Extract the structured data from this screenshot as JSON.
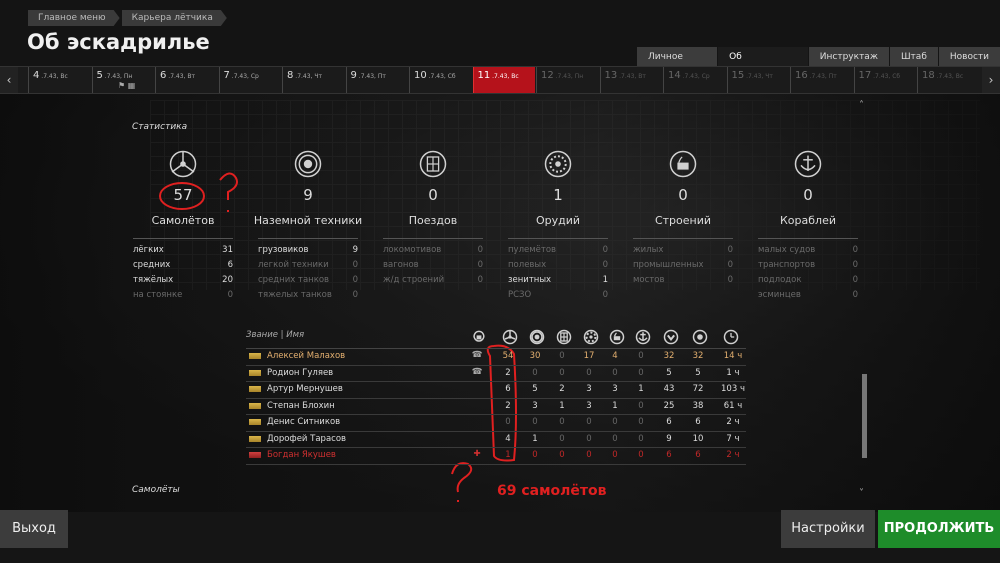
{
  "breadcrumb": [
    "Главное меню",
    "Карьера лётчика"
  ],
  "page_title": "Об эскадрилье",
  "tabs": [
    {
      "label": "Личное дело"
    },
    {
      "label": "Об эскадрилье",
      "active": true
    },
    {
      "label": "Инструктаж"
    },
    {
      "label": "Штаб"
    },
    {
      "label": "Новости"
    }
  ],
  "timeline": [
    {
      "num": "4",
      "date": "7.43, Вс"
    },
    {
      "num": "5",
      "date": "7.43, Пн"
    },
    {
      "num": "6",
      "date": "7.43, Вт"
    },
    {
      "num": "7",
      "date": "7.43, Ср"
    },
    {
      "num": "8",
      "date": "7.43, Чт"
    },
    {
      "num": "9",
      "date": "7.43, Пт"
    },
    {
      "num": "10",
      "date": "7.43, Сб"
    },
    {
      "num": "11",
      "date": "7.43, Вс"
    },
    {
      "num": "12",
      "date": "7.43, Пн"
    },
    {
      "num": "13",
      "date": "7.43, Вт"
    },
    {
      "num": "14",
      "date": "7.43, Ср"
    },
    {
      "num": "15",
      "date": "7.43, Чт"
    },
    {
      "num": "16",
      "date": "7.43, Пт"
    },
    {
      "num": "17",
      "date": "7.43, Сб"
    },
    {
      "num": "18",
      "date": "7.43, Вс"
    }
  ],
  "stats_section_label": "Статистика",
  "stats": [
    {
      "icon": "plane-icon",
      "value": "57",
      "label": "Самолётов",
      "rows": [
        {
          "k": "лёгких",
          "v": "31"
        },
        {
          "k": "средних",
          "v": "6"
        },
        {
          "k": "тяжёлых",
          "v": "20"
        },
        {
          "k": "на стоянке",
          "v": "0"
        }
      ]
    },
    {
      "icon": "ground-vehicle-icon",
      "value": "9",
      "label": "Наземной техники",
      "rows": [
        {
          "k": "грузовиков",
          "v": "9"
        },
        {
          "k": "легкой техники",
          "v": "0"
        },
        {
          "k": "средних танков",
          "v": "0"
        },
        {
          "k": "тяжелых танков",
          "v": "0"
        }
      ]
    },
    {
      "icon": "train-icon",
      "value": "0",
      "label": "Поездов",
      "rows": [
        {
          "k": "локомотивов",
          "v": "0"
        },
        {
          "k": "вагонов",
          "v": "0"
        },
        {
          "k": "ж/д строений",
          "v": "0"
        }
      ]
    },
    {
      "icon": "artillery-icon",
      "value": "1",
      "label": "Орудий",
      "rows": [
        {
          "k": "пулемётов",
          "v": "0"
        },
        {
          "k": "полевых",
          "v": "0"
        },
        {
          "k": "зенитных",
          "v": "1"
        },
        {
          "k": "РСЗО",
          "v": "0"
        }
      ]
    },
    {
      "icon": "building-icon",
      "value": "0",
      "label": "Строений",
      "rows": [
        {
          "k": "жилых",
          "v": "0"
        },
        {
          "k": "промышленных",
          "v": "0"
        },
        {
          "k": "мостов",
          "v": "0"
        }
      ]
    },
    {
      "icon": "ship-icon",
      "value": "0",
      "label": "Кораблей",
      "rows": [
        {
          "k": "малых судов",
          "v": "0"
        },
        {
          "k": "транспортов",
          "v": "0"
        },
        {
          "k": "подлодок",
          "v": "0"
        },
        {
          "k": "эсминцев",
          "v": "0"
        }
      ]
    }
  ],
  "roster": {
    "header": "Звание | Имя",
    "column_icons": [
      "status-icon",
      "plane-icon",
      "ground-vehicle-icon",
      "train-icon",
      "artillery-icon",
      "building-icon",
      "ship-icon",
      "sorties-icon",
      "target-icon",
      "clock-icon"
    ],
    "rows": [
      {
        "name": "Алексей Малахов",
        "mark": "☎",
        "style": "leader",
        "values": [
          "54",
          "30",
          "0",
          "17",
          "4",
          "0",
          "32",
          "32",
          "14 ч"
        ]
      },
      {
        "name": "Родион Гуляев",
        "mark": "☎",
        "style": "",
        "values": [
          "2",
          "0",
          "0",
          "0",
          "0",
          "0",
          "5",
          "5",
          "1 ч"
        ]
      },
      {
        "name": "Артур Мернушев",
        "mark": "",
        "style": "",
        "values": [
          "6",
          "5",
          "2",
          "3",
          "3",
          "1",
          "43",
          "72",
          "103 ч"
        ]
      },
      {
        "name": "Степан Блохин",
        "mark": "",
        "style": "",
        "values": [
          "2",
          "3",
          "1",
          "3",
          "1",
          "0",
          "25",
          "38",
          "61 ч"
        ]
      },
      {
        "name": "Денис Ситников",
        "mark": "",
        "style": "",
        "values": [
          "0",
          "0",
          "0",
          "0",
          "0",
          "0",
          "6",
          "6",
          "2 ч"
        ]
      },
      {
        "name": "Дорофей Тарасов",
        "mark": "",
        "style": "",
        "values": [
          "4",
          "1",
          "0",
          "0",
          "0",
          "0",
          "9",
          "10",
          "7 ч"
        ]
      },
      {
        "name": "Богдан Якушев",
        "mark": "✚",
        "style": "dead",
        "values": [
          "1",
          "0",
          "0",
          "0",
          "0",
          "0",
          "6",
          "6",
          "2 ч"
        ]
      }
    ]
  },
  "planes_section_label": "Самолёты",
  "annotation_text": "69 самолётов",
  "buttons": {
    "exit": "Выход",
    "settings": "Настройки",
    "continue": "ПРОДОЛЖИТЬ"
  },
  "colors": {
    "accent_red": "#b5121b",
    "continue_green": "#1e8c2a",
    "annotation_red": "#e02020"
  }
}
